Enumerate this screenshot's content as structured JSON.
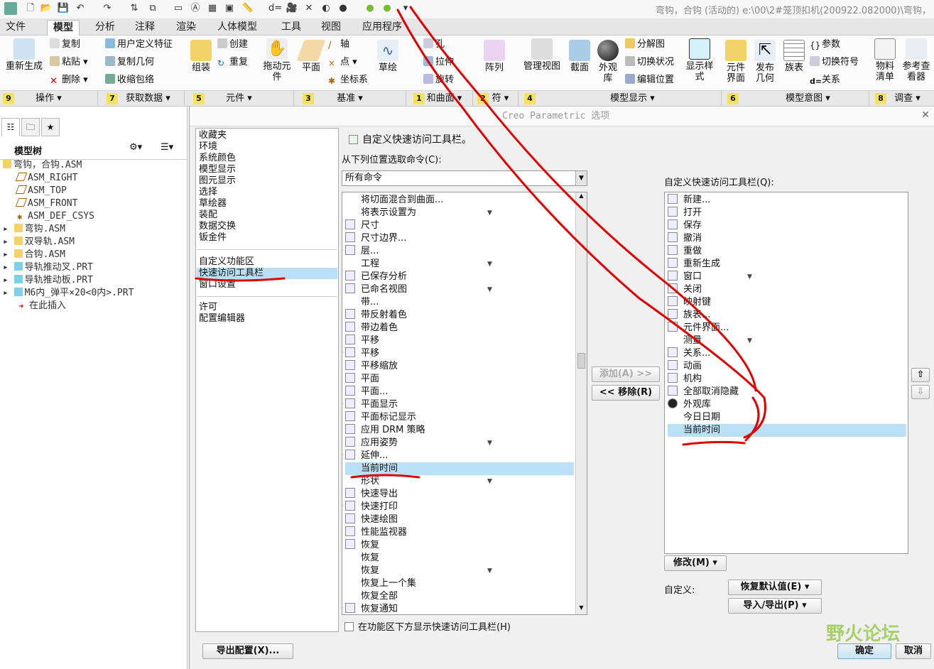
{
  "window_title": "弯钩，合钩 (活动的) e:\\00\\2#笼顶扣机(200922.082000)\\弯钩，",
  "ribbon_tabs": [
    "文件",
    "模型",
    "分析",
    "注释",
    "渲染",
    "人体模型",
    "工具",
    "视图",
    "应用程序"
  ],
  "ribbon": {
    "regenerate": "重新生成",
    "copy": "复制",
    "paste": "粘贴",
    "delete": "删除",
    "udf": "用户定义特征",
    "copy_geom": "复制几何",
    "shrinkwrap": "收缩包络",
    "assemble": "组装",
    "create": "创建",
    "repeat": "重复",
    "drag": "拖动元件",
    "plane": "平面",
    "axis": "轴",
    "point": "点",
    "csys": "坐标系",
    "sketch": "草绘",
    "hole": "孔",
    "extrude": "拉伸",
    "revolve": "旋转",
    "pattern": "阵列",
    "manage_views": "管理视图",
    "section": "截面",
    "appearance": "外观库",
    "exploded": "分解图",
    "toggle_status": "切换状况",
    "edit_position": "编辑位置",
    "display_style": "显示样式",
    "comp_interface": "元件界面",
    "publish_geom": "发布几何",
    "family_table": "族表",
    "params": "参数",
    "switch_symbol": "切换符号",
    "relations": "关系",
    "bom": "物料清单",
    "ref_viewer": "参考查看器"
  },
  "groups": [
    {
      "num": "9",
      "label": "操作"
    },
    {
      "num": "7",
      "label": "获取数据"
    },
    {
      "num": "5",
      "label": "元件"
    },
    {
      "num": "3",
      "label": "基准"
    },
    {
      "num": "1",
      "label": "和曲面"
    },
    {
      "num": "2",
      "label": "符"
    },
    {
      "num": "4",
      "label": ""
    },
    {
      "num": "",
      "label": "模型显示"
    },
    {
      "num": "6",
      "label": ""
    },
    {
      "num": "",
      "label": "模型意图"
    },
    {
      "num": "8",
      "label": "调查"
    }
  ],
  "model_tree": {
    "title": "模型树",
    "items": [
      "弯钩，合钩.ASM",
      "ASM_RIGHT",
      "ASM_TOP",
      "ASM_FRONT",
      "ASM_DEF_CSYS",
      "弯钩.ASM",
      "双导轨.ASM",
      "合钩.ASM",
      "导轨推动叉.PRT",
      "导轨推动板.PRT",
      "M6内_弹平×20<0内>.PRT",
      "在此插入"
    ]
  },
  "dialog": {
    "title": "Creo Parametric 选项",
    "categories_top": [
      "收藏夹",
      "环境",
      "系统颜色",
      "模型显示",
      "图元显示",
      "选择",
      "草绘器",
      "装配",
      "数据交换",
      "钣金件"
    ],
    "categories_mid": [
      "自定义功能区",
      "快速访问工具栏",
      "窗口设置"
    ],
    "categories_bot": [
      "许可",
      "配置编辑器"
    ],
    "customize_label": "自定义快速访问工具栏。",
    "choose_from_label": "从下列位置选取命令(C):",
    "choose_from_value": "所有命令",
    "commands": [
      "将切面混合到曲面...",
      "将表示设置为",
      "尺寸",
      "尺寸边界...",
      "层...",
      "工程",
      "已保存分析",
      "已命名视图",
      "带...",
      "带反射着色",
      "带边着色",
      "平移",
      "平移",
      "平移缩放",
      "平面",
      "平面...",
      "平面显示",
      "平面标记显示",
      "应用 DRM 策略",
      "应用姿势",
      "延伸...",
      "当前时间",
      "形状",
      "快速导出",
      "快速打印",
      "快速绘图",
      "性能监视器",
      "恢复",
      "恢复",
      "恢复",
      "恢复上一个集",
      "恢复全部",
      "恢复通知"
    ],
    "show_below_label": "在功能区下方显示快速访问工具栏(H)",
    "add_btn": "添加(A) >>",
    "remove_btn": "<< 移除(R)",
    "qat_label": "自定义快速访问工具栏(Q):",
    "qat_items": [
      "新建...",
      "打开",
      "保存",
      "撤消",
      "重做",
      "重新生成",
      "窗口",
      "关闭",
      "映射键",
      "族表...",
      "元件界面...",
      "测量",
      "关系...",
      "动画",
      "机构",
      "全部取消隐藏",
      "外观库",
      "今日日期",
      "当前时间"
    ],
    "modify_btn": "修改(M)",
    "customize_caption": "自定义:",
    "restore_btn": "恢复默认值(E)",
    "import_export_btn": "导入/导出(P)",
    "export_config_btn": "导出配置(X)...",
    "ok_btn": "确定",
    "cancel_btn": "取消"
  },
  "watermark": "野火论坛",
  "colors": {
    "selection": "#b9e0f5",
    "annotation": "#e00000",
    "group_badge": "#f7e35a"
  }
}
